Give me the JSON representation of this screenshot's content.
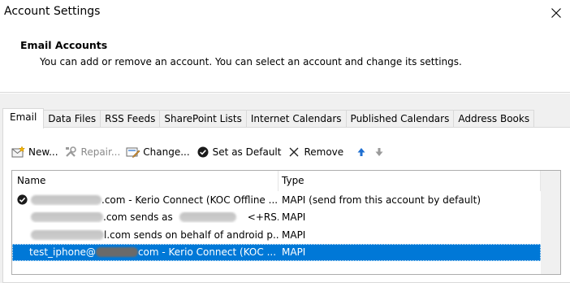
{
  "window": {
    "title": "Account Settings"
  },
  "header": {
    "heading": "Email Accounts",
    "description": "You can add or remove an account. You can select an account and change its settings."
  },
  "tabs": [
    {
      "label": "Email",
      "active": true
    },
    {
      "label": "Data Files"
    },
    {
      "label": "RSS Feeds"
    },
    {
      "label": "SharePoint Lists"
    },
    {
      "label": "Internet Calendars"
    },
    {
      "label": "Published Calendars"
    },
    {
      "label": "Address Books"
    }
  ],
  "toolbar": {
    "new_label": "New...",
    "repair_label": "Repair...",
    "change_label": "Change...",
    "set_default_label": "Set as Default",
    "remove_label": "Remove"
  },
  "accounts": {
    "columns": {
      "name": "Name",
      "type": "Type"
    },
    "rows": [
      {
        "name_a": ".com - Kerio Connect (KOC Offline ...",
        "type": "MAPI (send from this account by default)"
      },
      {
        "name_a": ".com sends as",
        "name_b": "<+RS...",
        "type": "MAPI"
      },
      {
        "name_a": "l.com sends on behalf of android p...",
        "type": "MAPI"
      },
      {
        "name_a": "test_iphone@",
        "name_b": "com - Kerio Connect (KOC ...",
        "type": "MAPI"
      }
    ]
  },
  "colors": {
    "selection": "#0078d7",
    "dialog_bg": "#f0f0f0",
    "up_arrow": "#1f6fd1"
  }
}
